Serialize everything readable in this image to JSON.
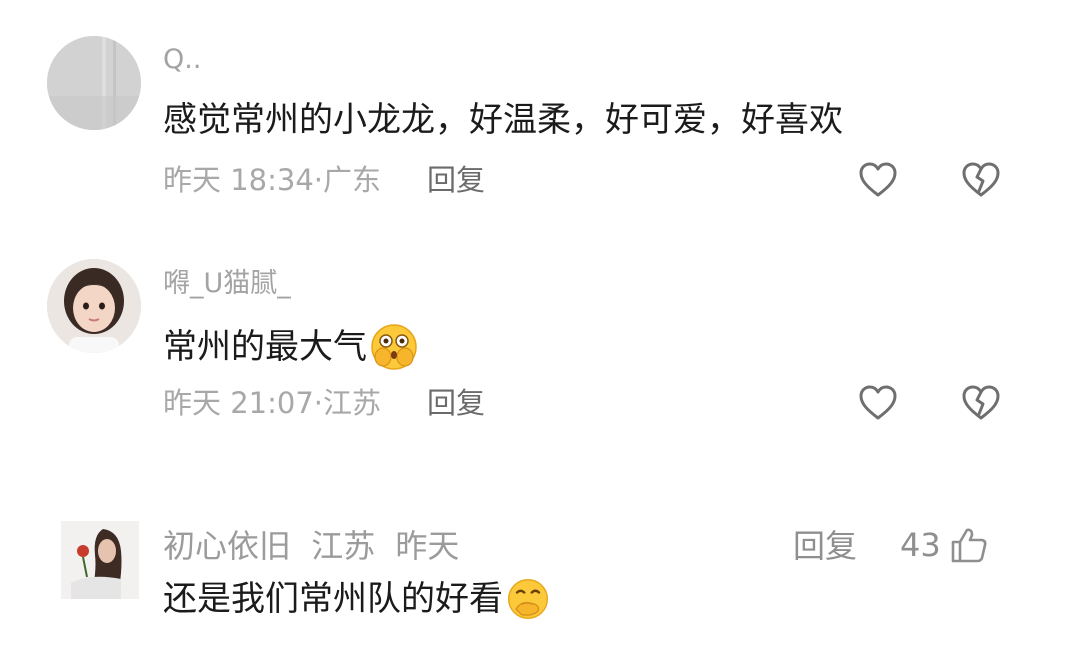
{
  "comments": [
    {
      "username": "Q..",
      "text": "感觉常州的小龙龙，好温柔，好可爱，好喜欢",
      "time": "昨天 18:34·广东",
      "reply_label": "回复",
      "like_icon": "heart-outline-icon",
      "dislike_icon": "broken-heart-icon"
    },
    {
      "username": "嘚_U猫腻_",
      "text": "常州的最大气",
      "emoji": "shocked-face-emoji",
      "time": "昨天 21:07·江苏",
      "reply_label": "回复",
      "like_icon": "heart-outline-icon",
      "dislike_icon": "broken-heart-icon"
    },
    {
      "username": "初心依旧",
      "location": "江苏",
      "date": "昨天",
      "text": "还是我们常州队的好看",
      "emoji": "hand-over-mouth-emoji",
      "reply_label": "回复",
      "like_count": "43",
      "like_icon": "thumbs-up-icon"
    }
  ],
  "colors": {
    "username": "#a3a3a3",
    "text": "#1b1b1b",
    "meta": "#a8a8a8",
    "icon": "#6f6f6f"
  }
}
